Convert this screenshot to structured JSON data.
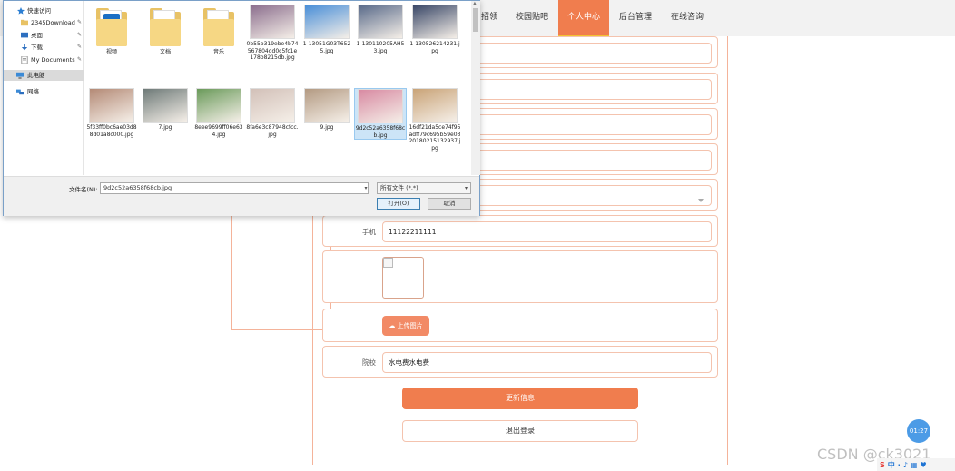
{
  "nav": {
    "items": [
      {
        "label": "招领"
      },
      {
        "label": "校园贴吧"
      },
      {
        "label": "个人中心"
      },
      {
        "label": "后台管理"
      },
      {
        "label": "在线咨询"
      }
    ],
    "active_index": 2
  },
  "form": {
    "phone_label": "手机",
    "phone_value": "11122211111",
    "upload_button": "上传图片",
    "school_label": "院校",
    "school_value": "水电费水电费",
    "update_button": "更新信息",
    "logout_button": "退出登录"
  },
  "dialog": {
    "sidebar": [
      {
        "label": "快速访问",
        "icon": "star-icon",
        "pinned": false
      },
      {
        "label": "2345Download",
        "icon": "folder-icon",
        "pinned": true
      },
      {
        "label": "桌面",
        "icon": "desktop-icon",
        "pinned": true
      },
      {
        "label": "下载",
        "icon": "download-icon",
        "pinned": true
      },
      {
        "label": "My Documents",
        "icon": "documents-icon",
        "pinned": true
      },
      {
        "label": "此电脑",
        "icon": "computer-icon",
        "pinned": false
      },
      {
        "label": "网络",
        "icon": "network-icon",
        "pinned": false
      }
    ],
    "files_row1": [
      {
        "name": "视频",
        "kind": "folder-video"
      },
      {
        "name": "文档",
        "kind": "folder"
      },
      {
        "name": "音乐",
        "kind": "folder"
      },
      {
        "name": "0b55b319ebe4b74567804dd0c5fc1e178b8215db.jpg",
        "kind": "image",
        "color": "#8c6f8e"
      },
      {
        "name": "1-13051G03T6525.jpg",
        "kind": "image",
        "color": "#4a8fd8"
      },
      {
        "name": "1-130110205AH53.jpg",
        "kind": "image",
        "color": "#5a6b8a"
      },
      {
        "name": "1-130526214231.jpg",
        "kind": "image",
        "color": "#3a4868"
      }
    ],
    "files_row2": [
      {
        "name": "5f33ff0bc6ae03d88d01a8c000.jpg",
        "kind": "image",
        "color": "#b48a76"
      },
      {
        "name": "7.jpg",
        "kind": "image",
        "color": "#6e7a78"
      },
      {
        "name": "8eee9699ff06e634.jpg",
        "kind": "image",
        "color": "#6a9a5a"
      },
      {
        "name": "8fa6e3c87948cfcc.jpg",
        "kind": "image",
        "color": "#d2c0b8"
      },
      {
        "name": "9.jpg",
        "kind": "image",
        "color": "#b39a82"
      },
      {
        "name": "9d2c52a6358f68cb.jpg",
        "kind": "image",
        "color": "#d88aa2"
      },
      {
        "name": "16df21da5ce74f95adff79c695b59e032018021513​2937.jpg",
        "kind": "image",
        "color": "#c9a377"
      }
    ],
    "selected_index_row2": 5,
    "filename_label": "文件名(N):",
    "filename_value": "9d2c52a6358f68cb.jpg",
    "filetype_value": "所有文件 (*.*)",
    "open_button": "打开(O)",
    "cancel_button": "取消"
  },
  "overlay": {
    "timer": "01:27",
    "watermark": "CSDN @ck3021",
    "ime": [
      "S",
      "中",
      "·",
      "♪",
      "▦",
      "♥"
    ]
  }
}
